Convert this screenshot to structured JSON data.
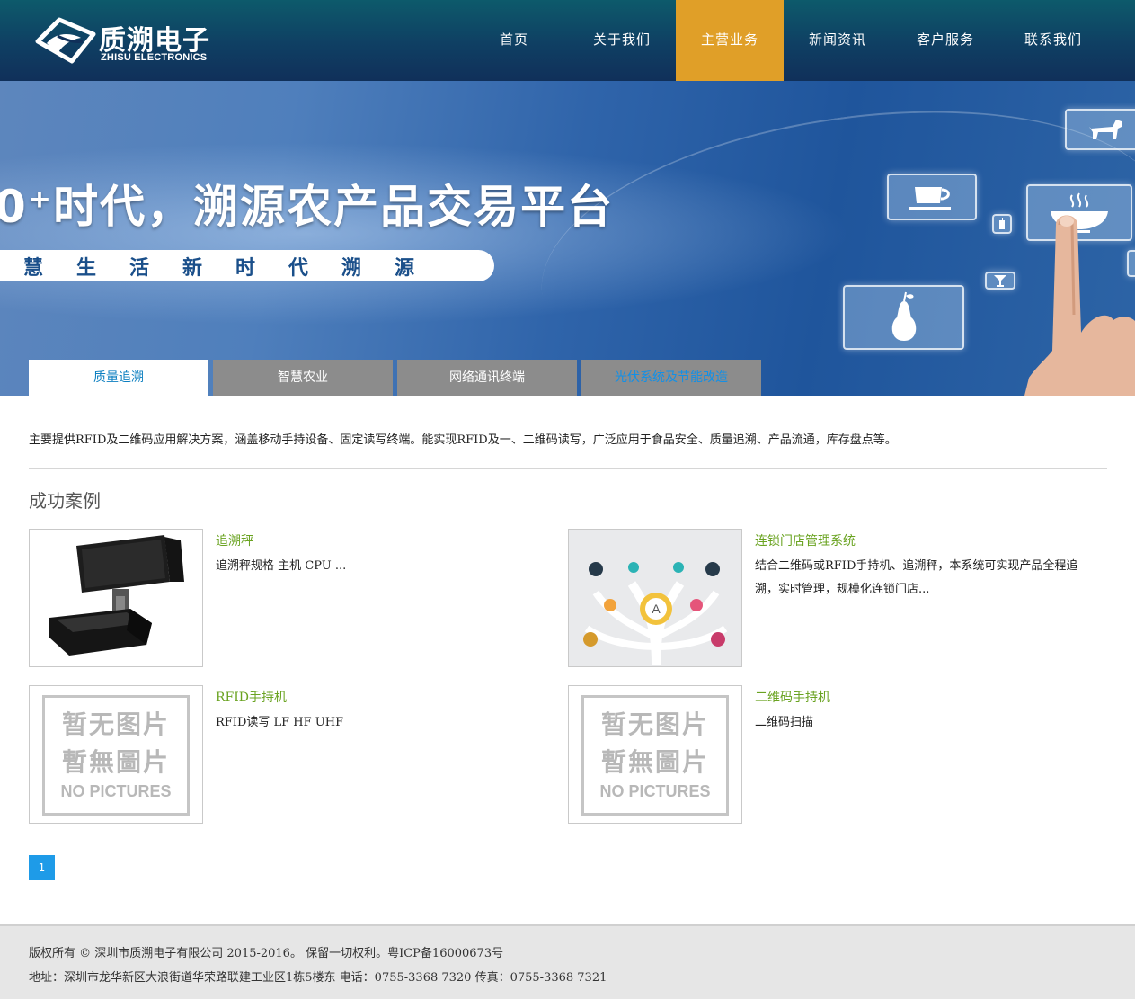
{
  "header": {
    "logo_cn": "质溯电子",
    "logo_en": "ZHISU ELECTRONICS",
    "nav": [
      {
        "label": "首页",
        "active": false
      },
      {
        "label": "关于我们",
        "active": false
      },
      {
        "label": "主营业务",
        "active": true
      },
      {
        "label": "新闻资讯",
        "active": false
      },
      {
        "label": "客户服务",
        "active": false
      },
      {
        "label": "联系我们",
        "active": false
      }
    ],
    "active_color": "#e09f28"
  },
  "banner": {
    "headline": "0⁺时代，溯源农产品交易平台",
    "subline": "慧生活新时代溯源",
    "tabs": [
      {
        "label": "质量追溯",
        "active": true
      },
      {
        "label": "智慧农业",
        "active": false
      },
      {
        "label": "网络通讯终端",
        "active": false
      },
      {
        "label": "光伏系统及节能改造",
        "active": false
      }
    ]
  },
  "main": {
    "intro": "主要提供RFID及二维码应用解决方案，涵盖移动手持设备、固定读写终端。能实现RFID及一、二维码读写，广泛应用于食品安全、质量追溯、产品流通，库存盘点等。",
    "section_title": "成功案例",
    "cases": [
      {
        "title": "追溯秤",
        "desc": "追溯秤规格 主机 CPU ...",
        "image": "pos-scale"
      },
      {
        "title": "连锁门店管理系统",
        "desc": "结合二维码或RFID手持机、追溯秤，本系统可实现产品全程追溯，实时管理，规模化连锁门店...",
        "image": "infographic"
      },
      {
        "title": "RFID手持机",
        "desc": "RFID读写 LF HF UHF",
        "image": "no-picture"
      },
      {
        "title": "二维码手持机",
        "desc": "二维码扫描",
        "image": "no-picture"
      }
    ],
    "no_picture": {
      "line1": "暂无图片",
      "line2": "暫無圖片",
      "line3": "NO PICTURES"
    },
    "pagination": {
      "current": "1"
    }
  },
  "footer": {
    "line1": "版权所有 © 深圳市质溯电子有限公司 2015-2016。 保留一切权利。粤ICP备16000673号",
    "line2": "地址：深圳市龙华新区大浪街道华荣路联建工业区1栋5楼东 电话：0755-3368 7320 传真：0755-3368 7321"
  }
}
